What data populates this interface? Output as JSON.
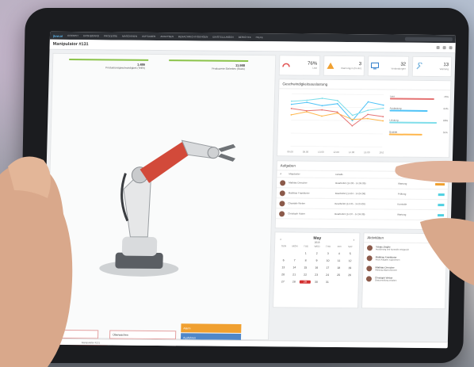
{
  "navbar": {
    "logo": "jlow.ai",
    "items": [
      "COCKPIT",
      "DASHBOARD",
      "PROZESSE",
      "MASCHINEN",
      "AUFGABEN",
      "ANALYSEN",
      "BENACHRICHTIGUNGEN",
      "EINSTELLUNGEN",
      "BERICHTE",
      "HILFE"
    ]
  },
  "page": {
    "title": "Manipulator #131"
  },
  "left": {
    "kpi1": {
      "value": "1.486",
      "label": "Produktionsgeschwindigkeit (Teil/h)"
    },
    "kpi2": {
      "value": "11.988",
      "label": "Produzierte Einheiten (Stück)"
    },
    "buttons": [
      {
        "label": "Auswahl",
        "color": "#ffffff"
      },
      {
        "label": "Überwachen",
        "color": "#ffffff"
      },
      {
        "label": "Alarm",
        "color": "#f0a030"
      },
      {
        "label": "Stoppen",
        "color": "#c62828"
      },
      {
        "label": "Bearbeiten",
        "color": "#ffffff"
      },
      {
        "label": "Ausführen",
        "color": "#4f87c9"
      }
    ],
    "footer_label": "Manipulator #131"
  },
  "kpis": [
    {
      "icon": "gauge-icon",
      "value": "76%",
      "label": "Last",
      "color": "#e25555"
    },
    {
      "icon": "warning-icon",
      "value": "3",
      "label": "Warnungen (heute)",
      "color": "#f0a030"
    },
    {
      "icon": "monitor-icon",
      "value": "32",
      "label": "Verbindungen",
      "color": "#2979c9"
    },
    {
      "icon": "wrench-icon",
      "value": "13",
      "label": "Wartung",
      "color": "#7fb8e0"
    }
  ],
  "chart_card": {
    "title": "Geschwindigkeitsauslastung",
    "legend": [
      {
        "label": "Last",
        "value": "76%",
        "color": "#e57373"
      },
      {
        "label": "Auslastung",
        "value": "64%",
        "color": "#4fc3f7"
      },
      {
        "label": "Leistung",
        "value": "80%",
        "color": "#80deea"
      },
      {
        "label": "Qualität",
        "value": "55%",
        "color": "#ffb74d"
      }
    ]
  },
  "tasks": {
    "title": "Aufgaben",
    "headers": [
      "#",
      "Mitarbeiter",
      "Details",
      "Aufgabe"
    ],
    "rows": [
      {
        "name": "Mathias Drescher",
        "detail": "Bearbeitet (14.03 - 14.04.06)",
        "task": "Wartung",
        "color": "#f0a030"
      },
      {
        "name": "Matthias Frankfurter",
        "detail": "Bearbeitet (14.04 - 14.04.06)",
        "task": "Prüfung",
        "color": "#4dd0e1"
      },
      {
        "name": "Chantale Weber",
        "detail": "Bearbeitet (14.05 - 14.04.06)",
        "task": "Kontrolle",
        "color": "#4dd0e1"
      },
      {
        "name": "Christoph Huber",
        "detail": "Bearbeitet (14.07 - 14.04.06)",
        "task": "Wartung",
        "color": "#4dd0e1"
      }
    ]
  },
  "calendar": {
    "month": "May",
    "year": "2018",
    "days_header": [
      "SUN",
      "MON",
      "TUE",
      "WED",
      "THU",
      "FRI",
      "SAT"
    ],
    "weeks": [
      [
        "",
        "",
        "1",
        "2",
        "3",
        "4",
        "5"
      ],
      [
        "6",
        "7",
        "8",
        "9",
        "10",
        "11",
        "12"
      ],
      [
        "13",
        "14",
        "15",
        "16",
        "17",
        "18",
        "19"
      ],
      [
        "20",
        "21",
        "22",
        "23",
        "24",
        "25",
        "26"
      ],
      [
        "27",
        "28",
        "29",
        "30",
        "31",
        "",
        ""
      ]
    ],
    "selected": "29"
  },
  "activity": {
    "title": "Aktivitäten",
    "items": [
      {
        "name": "Tobias Ziegler",
        "text": "Ausführung und Kontrolle erfolgreich"
      },
      {
        "name": "Matthias Frankfurter",
        "text": "Neue Aufgabe zugewiesen"
      },
      {
        "name": "Matthias Drescher",
        "text": "Wartung abgeschlossen"
      },
      {
        "name": "Christoph Weber",
        "text": "Statusmeldung erhalten"
      }
    ]
  },
  "chart_data": {
    "type": "line",
    "title": "Geschwindigkeitsauslastung",
    "x": [
      "06.00",
      "08.00",
      "10.00",
      "12.00",
      "14.00",
      "16.00",
      "18.00"
    ],
    "series": [
      {
        "name": "Last",
        "values": [
          72,
          68,
          70,
          66,
          40,
          62,
          58
        ]
      },
      {
        "name": "Auslastung",
        "values": [
          80,
          84,
          78,
          82,
          50,
          86,
          80
        ]
      },
      {
        "name": "Leistung",
        "values": [
          86,
          88,
          92,
          88,
          60,
          70,
          74
        ]
      },
      {
        "name": "Qualität",
        "values": [
          60,
          66,
          58,
          64,
          52,
          54,
          50
        ]
      }
    ],
    "ylim": [
      0,
      100
    ]
  }
}
